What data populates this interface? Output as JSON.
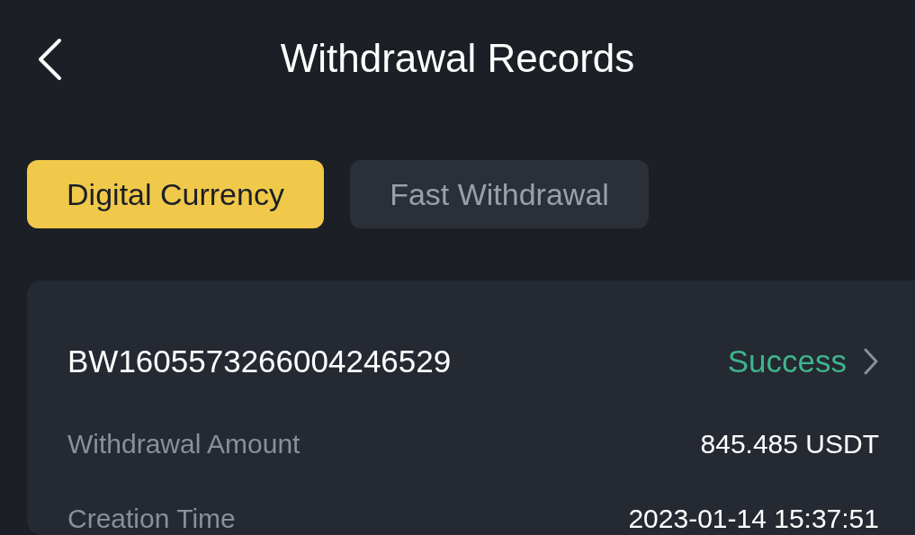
{
  "header": {
    "title": "Withdrawal Records"
  },
  "tabs": [
    {
      "label": "Digital Currency",
      "selected": true
    },
    {
      "label": "Fast Withdrawal",
      "selected": false
    }
  ],
  "record": {
    "id": "BW1605573266004246529",
    "status": "Success",
    "kind": "success",
    "fields": [
      {
        "label": "Withdrawal Amount",
        "value": "845.485 USDT"
      },
      {
        "label": "Creation Time",
        "value": "2023-01-14 15:37:51"
      }
    ]
  }
}
